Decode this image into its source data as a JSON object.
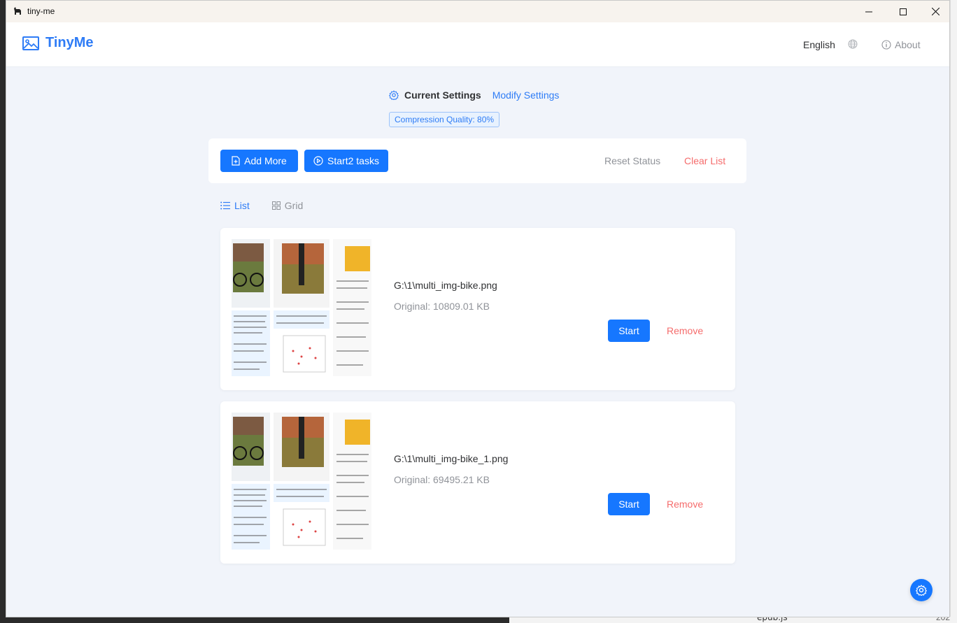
{
  "window": {
    "title": "tiny-me"
  },
  "header": {
    "brand": "TinyMe",
    "language": "English",
    "about": "About"
  },
  "settings": {
    "current_label": "Current Settings",
    "modify_label": "Modify Settings",
    "quality_tag": "Compression Quality: 80%"
  },
  "toolbar": {
    "add_more": "Add More",
    "start_tasks": "Start2 tasks",
    "reset_status": "Reset Status",
    "clear_list": "Clear List"
  },
  "view": {
    "list": "List",
    "grid": "Grid",
    "active": "list"
  },
  "files": [
    {
      "name": "G:\\1\\multi_img-bike.png",
      "original": "Original: 10809.01 KB",
      "start": "Start",
      "remove": "Remove"
    },
    {
      "name": "G:\\1\\multi_img-bike_1.png",
      "original": "Original: 69495.21 KB",
      "start": "Start",
      "remove": "Remove"
    }
  ],
  "desktop": {
    "bottom_item": "epub.js",
    "bottom_year": "202"
  },
  "colors": {
    "primary": "#1677ff",
    "brand": "#2e7cf6",
    "danger": "#f56c6c",
    "muted": "#909399",
    "background": "#f1f4fa"
  },
  "icons": {
    "logo": "image-icon",
    "globe": "globe-icon",
    "about": "info-icon",
    "settings": "gear-icon",
    "add": "file-add-icon",
    "start": "play-circle-icon",
    "list": "list-icon",
    "grid": "grid-icon",
    "fab": "gear-icon"
  }
}
